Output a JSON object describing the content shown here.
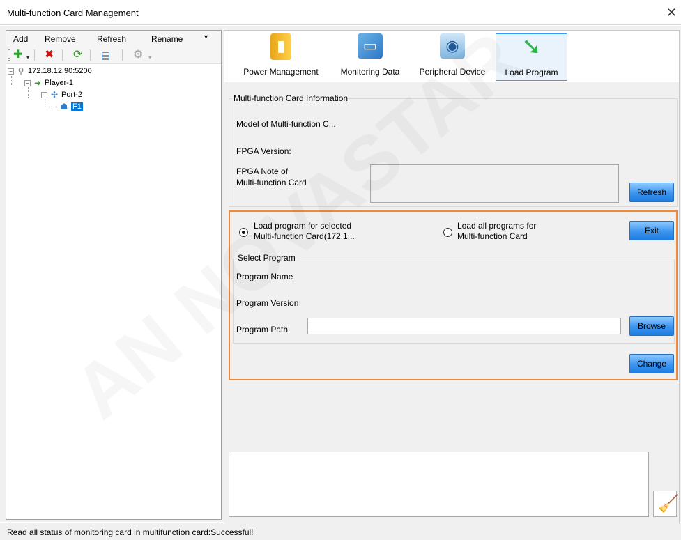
{
  "window": {
    "title": "Multi-function Card Management"
  },
  "menu": {
    "add": "Add",
    "remove": "Remove",
    "refresh": "Refresh",
    "rename": "Rename"
  },
  "toolbar_icons": [
    "plus-icon",
    "delete-icon",
    "refresh-icon",
    "export-icon",
    "settings-icon"
  ],
  "tree": {
    "root": "172.18.12.90:5200",
    "player": "Player-1",
    "port": "Port-2",
    "card": "F1"
  },
  "tabs": [
    {
      "label": "Power Management",
      "icon": "battery-icon"
    },
    {
      "label": "Monitoring Data",
      "icon": "monitor-icon"
    },
    {
      "label": "Peripheral Device",
      "icon": "camera-device-icon"
    },
    {
      "label": "Load Program",
      "icon": "green-arrow-icon",
      "active": true
    }
  ],
  "info": {
    "group_title": "Multi-function Card Information",
    "model_label": "Model of Multi-function C...",
    "fpga_version_label": "FPGA Version:",
    "fpga_note_label_1": "FPGA Note of",
    "fpga_note_label_2": "Multi-function Card",
    "refresh_button": "Refresh"
  },
  "load": {
    "radio_selected_line1": "Load program for selected",
    "radio_selected_line2": "Multi-function Card(172.1...",
    "radio_all_line1": "Load all programs for",
    "radio_all_line2": "Multi-function Card",
    "selected_option": "selected",
    "exit_button": "Exit",
    "select_program_title": "Select Program",
    "program_name_label": "Program Name",
    "program_version_label": "Program Version",
    "program_path_label": "Program Path",
    "program_path_value": "",
    "browse_button": "Browse",
    "change_button": "Change"
  },
  "status": {
    "message": "Read all status of monitoring card in multifunction card:Successful!"
  },
  "colors": {
    "accent": "#3b94f0",
    "highlight": "#f0883a",
    "selection": "#0078d7"
  }
}
